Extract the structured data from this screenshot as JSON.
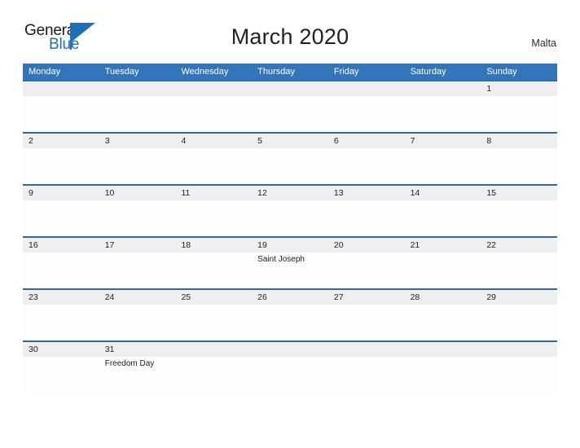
{
  "brand": {
    "name_part1": "General",
    "name_part2": "Blue",
    "accent_color": "#1f6fb2",
    "mark_icon": "flag-triangle-icon"
  },
  "header": {
    "title": "March 2020",
    "locale": "Malta"
  },
  "theme": {
    "header_blue": "#3275b8",
    "row_rule_blue": "#2e6da8",
    "number_band_gray": "#efefef",
    "text_dark": "#222222"
  },
  "calendar": {
    "month": "March",
    "year": "2020",
    "country": "Malta",
    "weekdays": [
      "Monday",
      "Tuesday",
      "Wednesday",
      "Thursday",
      "Friday",
      "Saturday",
      "Sunday"
    ],
    "weeks": [
      [
        {
          "day": "",
          "event": ""
        },
        {
          "day": "",
          "event": ""
        },
        {
          "day": "",
          "event": ""
        },
        {
          "day": "",
          "event": ""
        },
        {
          "day": "",
          "event": ""
        },
        {
          "day": "",
          "event": ""
        },
        {
          "day": "1",
          "event": ""
        }
      ],
      [
        {
          "day": "2",
          "event": ""
        },
        {
          "day": "3",
          "event": ""
        },
        {
          "day": "4",
          "event": ""
        },
        {
          "day": "5",
          "event": ""
        },
        {
          "day": "6",
          "event": ""
        },
        {
          "day": "7",
          "event": ""
        },
        {
          "day": "8",
          "event": ""
        }
      ],
      [
        {
          "day": "9",
          "event": ""
        },
        {
          "day": "10",
          "event": ""
        },
        {
          "day": "11",
          "event": ""
        },
        {
          "day": "12",
          "event": ""
        },
        {
          "day": "13",
          "event": ""
        },
        {
          "day": "14",
          "event": ""
        },
        {
          "day": "15",
          "event": ""
        }
      ],
      [
        {
          "day": "16",
          "event": ""
        },
        {
          "day": "17",
          "event": ""
        },
        {
          "day": "18",
          "event": ""
        },
        {
          "day": "19",
          "event": "Saint Joseph"
        },
        {
          "day": "20",
          "event": ""
        },
        {
          "day": "21",
          "event": ""
        },
        {
          "day": "22",
          "event": ""
        }
      ],
      [
        {
          "day": "23",
          "event": ""
        },
        {
          "day": "24",
          "event": ""
        },
        {
          "day": "25",
          "event": ""
        },
        {
          "day": "26",
          "event": ""
        },
        {
          "day": "27",
          "event": ""
        },
        {
          "day": "28",
          "event": ""
        },
        {
          "day": "29",
          "event": ""
        }
      ],
      [
        {
          "day": "30",
          "event": ""
        },
        {
          "day": "31",
          "event": "Freedom Day"
        },
        {
          "day": "",
          "event": ""
        },
        {
          "day": "",
          "event": ""
        },
        {
          "day": "",
          "event": ""
        },
        {
          "day": "",
          "event": ""
        },
        {
          "day": "",
          "event": ""
        }
      ]
    ]
  }
}
